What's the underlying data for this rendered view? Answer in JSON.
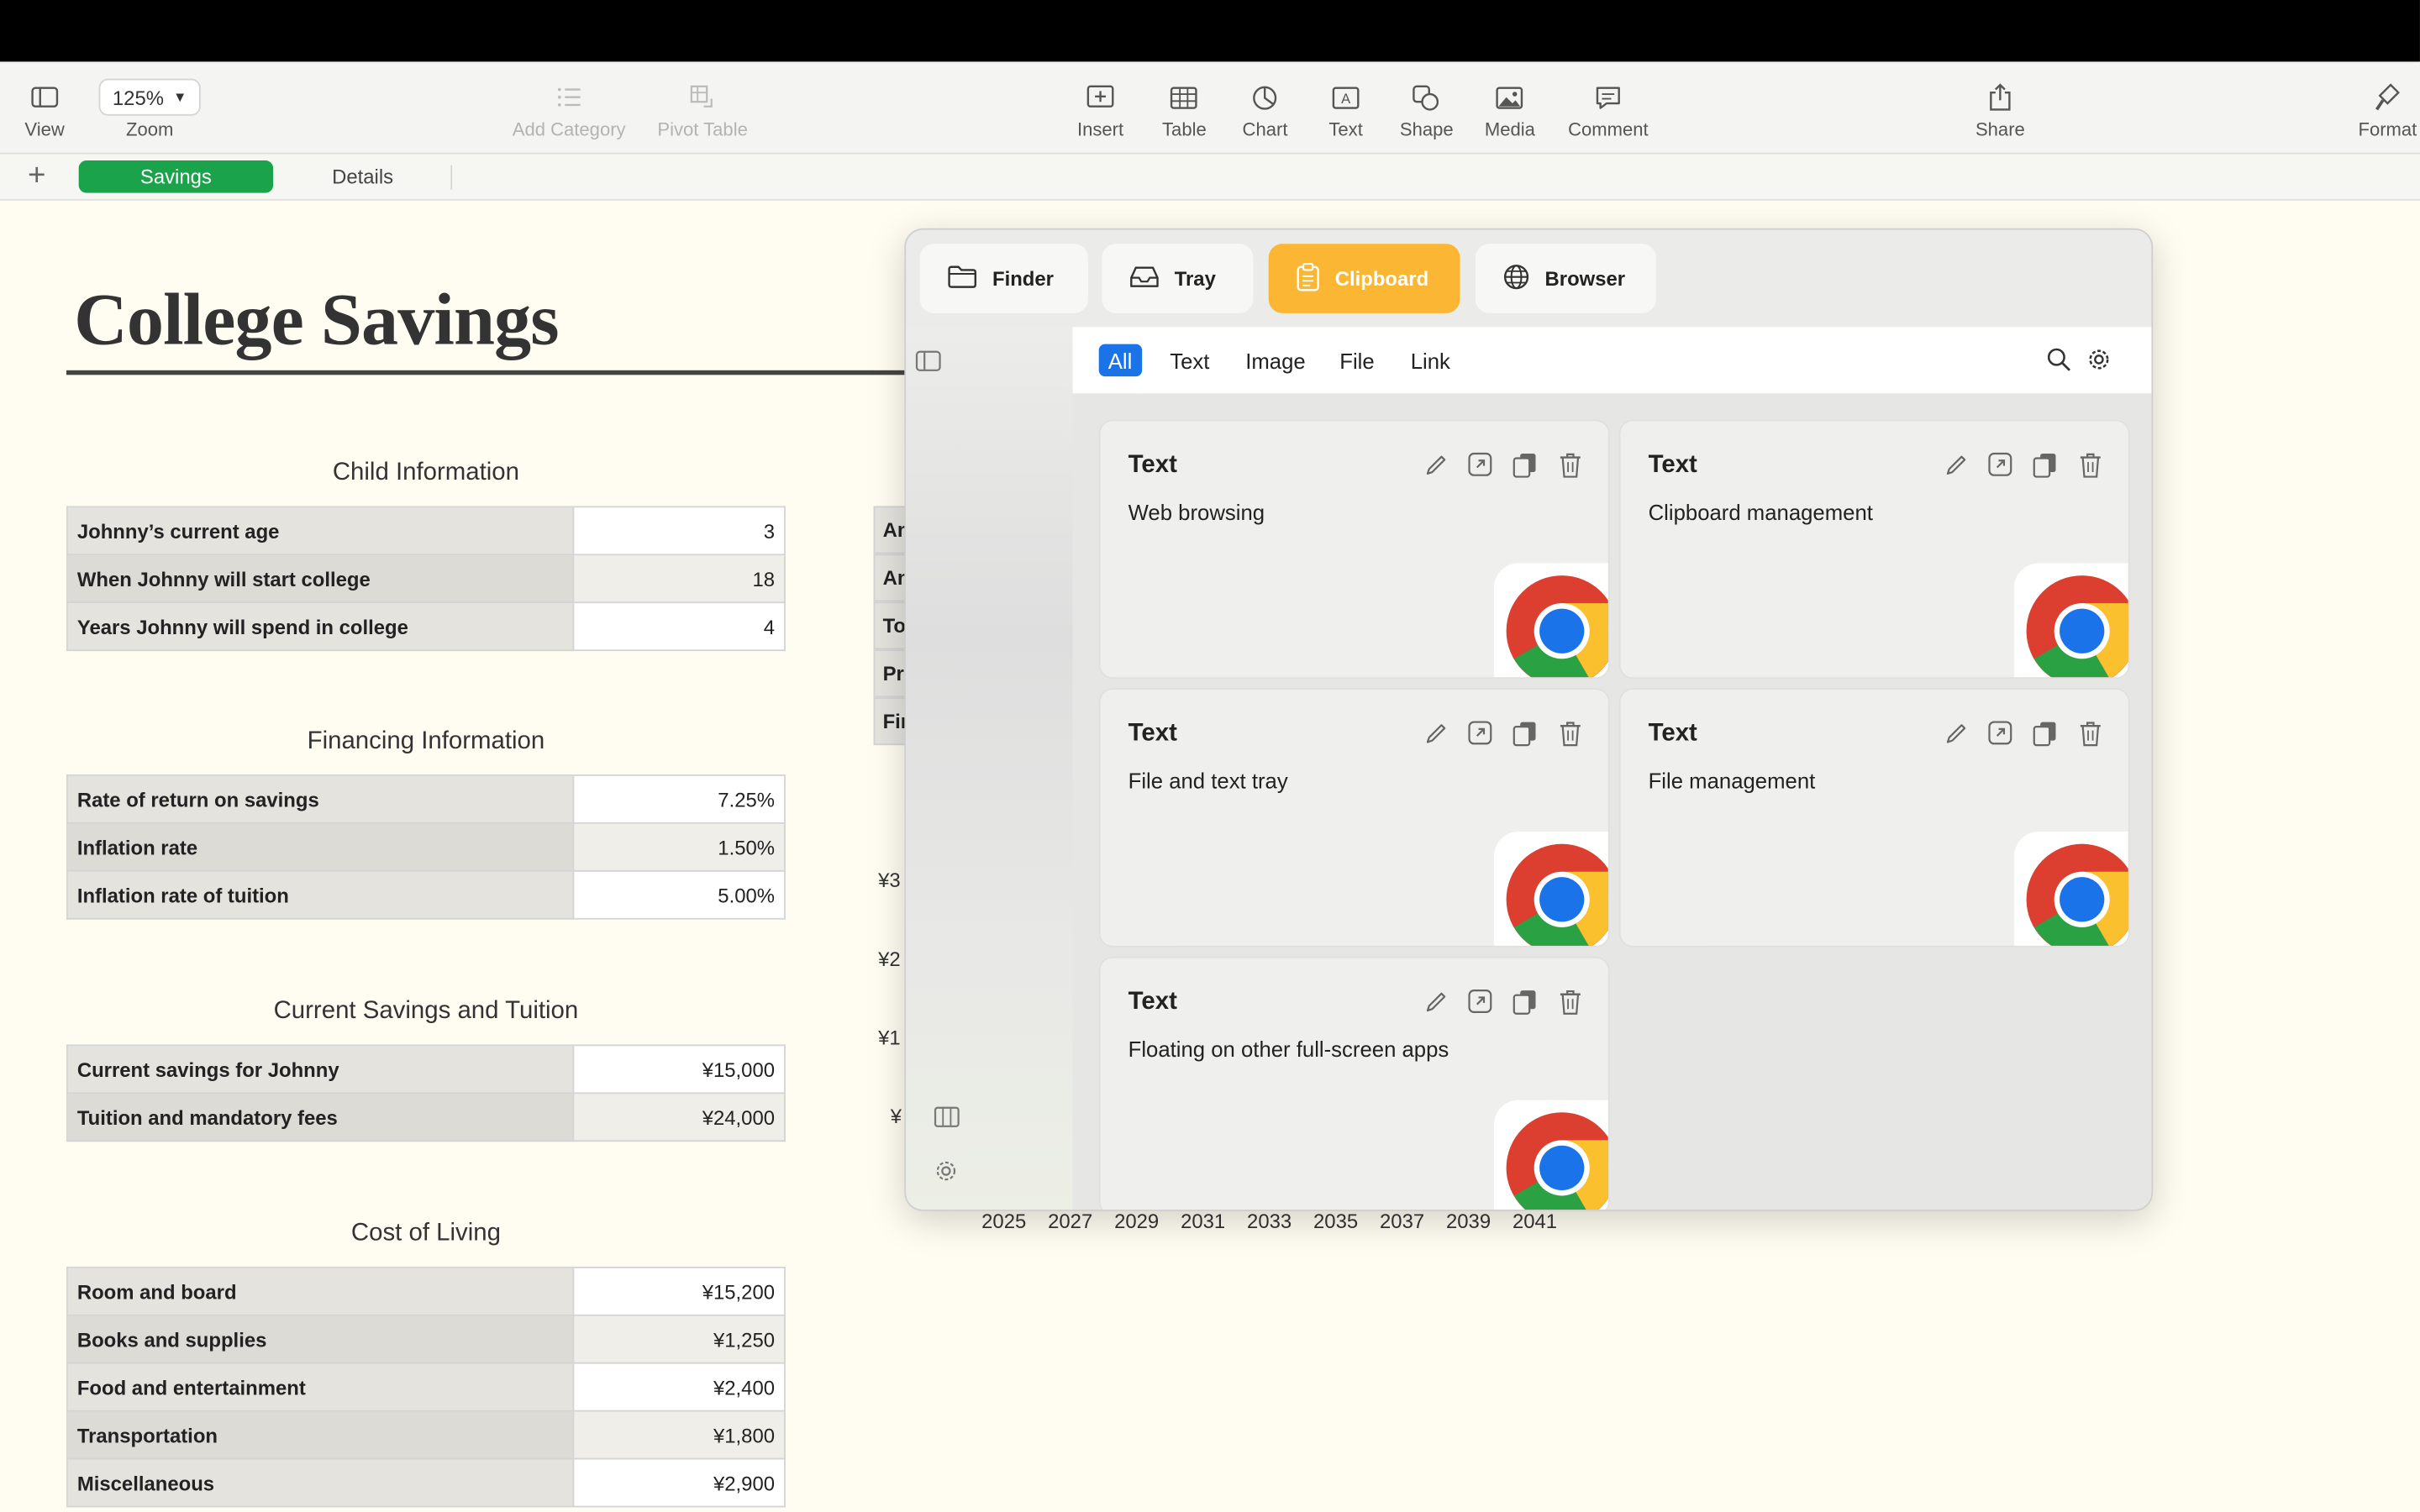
{
  "toolbar": {
    "view": "View",
    "zoom_value": "125%",
    "zoom": "Zoom",
    "add_category": "Add Category",
    "pivot_table": "Pivot Table",
    "insert": "Insert",
    "table": "Table",
    "chart": "Chart",
    "text": "Text",
    "shape": "Shape",
    "media": "Media",
    "comment": "Comment",
    "share": "Share",
    "format": "Format"
  },
  "sheets": {
    "add": "+",
    "active": "Savings",
    "other": "Details"
  },
  "doc": {
    "title": "College Savings",
    "sections": [
      {
        "title": "Child Information",
        "rows": [
          {
            "label": "Johnny’s current age",
            "value": "3"
          },
          {
            "label": "When Johnny will start college",
            "value": "18"
          },
          {
            "label": "Years Johnny will spend in college",
            "value": "4"
          }
        ]
      },
      {
        "title": "Financing Information",
        "rows": [
          {
            "label": "Rate of return on savings",
            "value": "7.25%"
          },
          {
            "label": "Inflation rate",
            "value": "1.50%"
          },
          {
            "label": "Inflation rate of tuition",
            "value": "5.00%"
          }
        ]
      },
      {
        "title": "Current Savings and Tuition",
        "rows": [
          {
            "label": "Current savings for Johnny",
            "value": "¥15,000"
          },
          {
            "label": "Tuition and mandatory fees",
            "value": "¥24,000"
          }
        ]
      },
      {
        "title": "Cost of Living",
        "rows": [
          {
            "label": "Room and board",
            "value": "¥15,200"
          },
          {
            "label": "Books and supplies",
            "value": "¥1,250"
          },
          {
            "label": "Food and entertainment",
            "value": "¥2,400"
          },
          {
            "label": "Transportation",
            "value": "¥1,800"
          },
          {
            "label": "Miscellaneous",
            "value": "¥2,900"
          }
        ]
      }
    ],
    "partial_cells": [
      "An",
      "An",
      "To",
      "Pr",
      "Fir"
    ],
    "partial_y_axis": [
      "¥3",
      "¥2",
      "¥1",
      "¥"
    ],
    "x_axis_years": [
      "2025",
      "2027",
      "2029",
      "2031",
      "2033",
      "2035",
      "2037",
      "2039",
      "2041"
    ]
  },
  "panel": {
    "tabs": [
      "Finder",
      "Tray",
      "Clipboard",
      "Browser"
    ],
    "active_tab": "Clipboard",
    "filters": [
      "All",
      "Text",
      "Image",
      "File",
      "Link"
    ],
    "active_filter": "All",
    "cards": [
      {
        "type": "Text",
        "content": "Web browsing",
        "app_icon": "chrome-icon"
      },
      {
        "type": "Text",
        "content": "Clipboard management",
        "app_icon": "chrome-icon"
      },
      {
        "type": "Text",
        "content": "File and text tray",
        "app_icon": "chrome-icon"
      },
      {
        "type": "Text",
        "content": "File management",
        "app_icon": "chrome-icon"
      },
      {
        "type": "Text",
        "content": "Floating on other full-screen apps",
        "app_icon": "chrome-icon"
      }
    ]
  },
  "colors": {
    "sheet_tab_active": "#1aa34a",
    "clipboard_tab": "#fbb733",
    "filter_active": "#1b73e8",
    "page_bg": "#fffdf1"
  }
}
